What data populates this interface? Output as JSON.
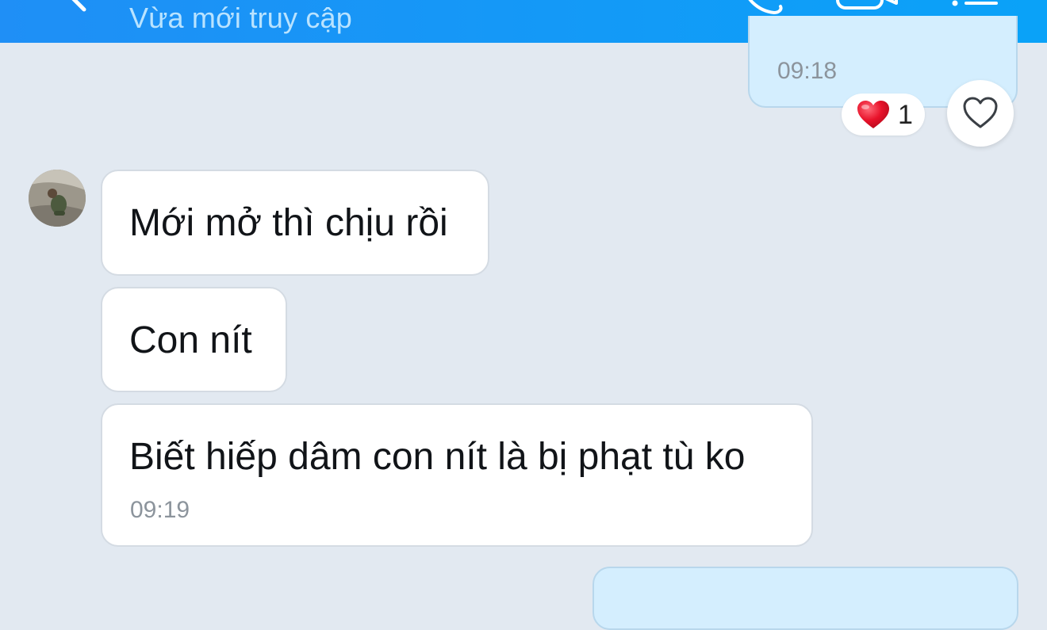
{
  "header": {
    "status": "Vừa mới truy cập"
  },
  "messages": [
    {
      "direction": "outgoing",
      "time": "09:18",
      "reaction": {
        "emoji": "heart-icon",
        "count": "1"
      }
    },
    {
      "direction": "incoming",
      "text": "Mới mở thì chịu rồi"
    },
    {
      "direction": "incoming",
      "text": "Con nít"
    },
    {
      "direction": "incoming",
      "text": "Biết hiếp dâm con nít là bị phạt tù ko",
      "time": "09:19"
    },
    {
      "direction": "outgoing"
    }
  ],
  "colors": {
    "header_gradient_start": "#1f8ff6",
    "header_gradient_end": "#0aa2f8",
    "chat_background": "#e2e9f1",
    "outgoing_bubble": "#d4eefe",
    "incoming_bubble": "#ffffff",
    "heart": "#e8122a"
  }
}
